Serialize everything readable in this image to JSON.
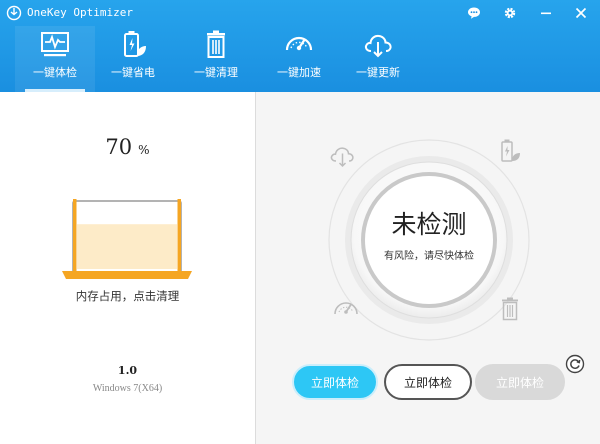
{
  "window": {
    "title": "OneKey Optimizer"
  },
  "titlebar_icons": [
    "chat-icon",
    "gear-icon",
    "minimize-icon",
    "close-icon"
  ],
  "nav": {
    "items": [
      {
        "label": "一键体检",
        "icon": "monitor-pulse-icon",
        "active": true
      },
      {
        "label": "一键省电",
        "icon": "battery-leaf-icon",
        "active": false
      },
      {
        "label": "一键清理",
        "icon": "trash-icon",
        "active": false
      },
      {
        "label": "一键加速",
        "icon": "speedometer-icon",
        "active": false
      },
      {
        "label": "一键更新",
        "icon": "cloud-download-icon",
        "active": false
      }
    ]
  },
  "memory": {
    "value": "70",
    "unit": "%",
    "usage_fraction": 0.7,
    "hint": "内存占用，点击清理"
  },
  "app_version": "1.0",
  "os_info": "Windows 7(X64)",
  "status": {
    "title": "未检测",
    "subtitle": "有风险，请尽快体检"
  },
  "buttons": {
    "primary": "立即体检",
    "outline": "立即体检",
    "disabled": "立即体检"
  },
  "colors": {
    "header": "#1a8fe0",
    "accent": "#2dc7f5",
    "laptop": "#f5a623",
    "screen_fill": "#fdebc8"
  }
}
